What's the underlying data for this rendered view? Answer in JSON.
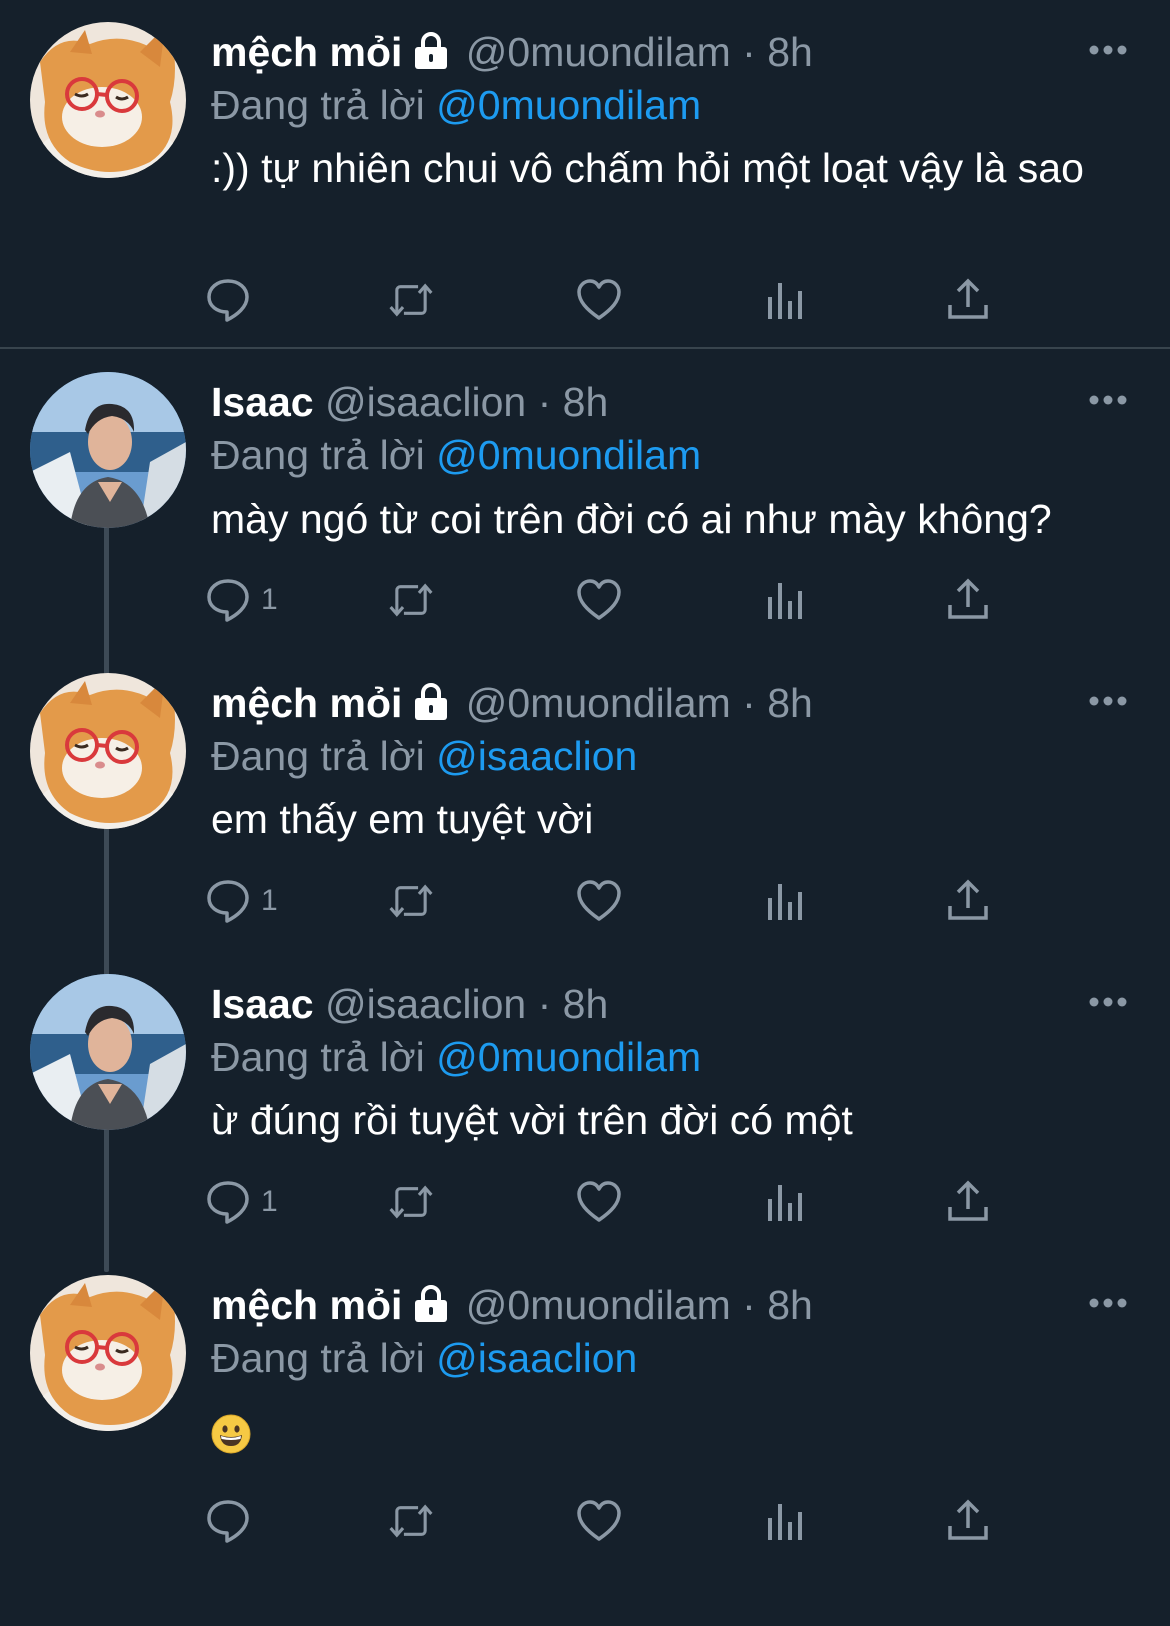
{
  "colors": {
    "background": "#15202b",
    "text": "#ffffff",
    "muted": "#8b98a5",
    "accent": "#1d9bf0",
    "divider": "#38444d"
  },
  "reply_prefix": "Đang trả lời",
  "tweets": [
    {
      "name": "mệch mỏi",
      "locked": true,
      "handle": "@0muondilam",
      "sep": "·",
      "time": "8h",
      "reply_to": "@0muondilam",
      "text": ":)) tự nhiên chui vô chấm hỏi một loạt vậy là sao",
      "reply_count": "",
      "avatar": "cat-avatar"
    },
    {
      "name": "Isaac",
      "locked": false,
      "handle": "@isaaclion",
      "sep": "·",
      "time": "8h",
      "reply_to": "@0muondilam",
      "text": "mày ngó từ coi trên đời có ai như mày không?",
      "reply_count": "1",
      "avatar": "man-avatar"
    },
    {
      "name": "mệch mỏi",
      "locked": true,
      "handle": "@0muondilam",
      "sep": "·",
      "time": "8h",
      "reply_to": "@isaaclion",
      "text": "em thấy em tuyệt vời",
      "reply_count": "1",
      "avatar": "cat-avatar"
    },
    {
      "name": "Isaac",
      "locked": false,
      "handle": "@isaaclion",
      "sep": "·",
      "time": "8h",
      "reply_to": "@0muondilam",
      "text": "ừ đúng rồi tuyệt vời trên đời có một",
      "reply_count": "1",
      "avatar": "man-avatar"
    },
    {
      "name": "mệch mỏi",
      "locked": true,
      "handle": "@0muondilam",
      "sep": "·",
      "time": "8h",
      "reply_to": "@isaaclion",
      "text": "",
      "emoji": "grinning-face-emoji",
      "reply_count": "",
      "avatar": "cat-avatar"
    }
  ],
  "icons": {
    "reply": "reply-icon",
    "retweet": "retweet-icon",
    "like": "heart-icon",
    "views": "views-icon",
    "share": "share-icon",
    "more": "more-icon",
    "lock": "lock-icon"
  }
}
